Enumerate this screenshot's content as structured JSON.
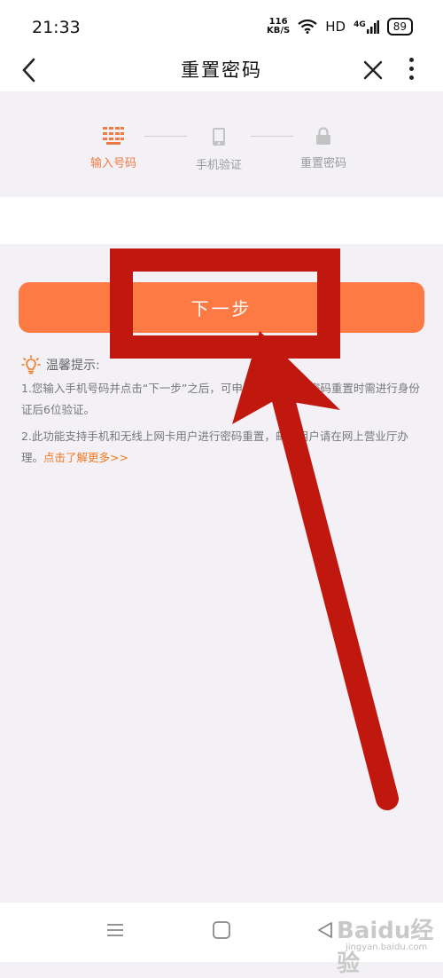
{
  "status_bar": {
    "time": "21:33",
    "speed_value": "116",
    "speed_unit": "KB/S",
    "hd": "HD",
    "network": "4G",
    "battery": "89"
  },
  "nav": {
    "title": "重置密码"
  },
  "steps": [
    {
      "label": "输入号码",
      "icon": "keypad-icon",
      "active": true
    },
    {
      "label": "手机验证",
      "icon": "phone-icon",
      "active": false
    },
    {
      "label": "重置密码",
      "icon": "lock-icon",
      "active": false
    }
  ],
  "next_button": {
    "label": "下一步"
  },
  "tips": {
    "heading": "温馨提示:",
    "line1": "1.您输入手机号码并点击“下一步”之后，可申请密码重置，密码重置时需进行身份证后6位验证。",
    "line2": "2.此功能支持手机和无线上网卡用户进行密码重置，邮箱用户请在网上营业厅办理。",
    "more_link": "点击了解更多>>"
  },
  "watermark": {
    "brand": "Baidu经验",
    "url": "jingyan.baidu.com"
  },
  "colors": {
    "accent": "#fe7a45",
    "annotation": "#c0170f",
    "page_bg": "#f3f1f5"
  }
}
